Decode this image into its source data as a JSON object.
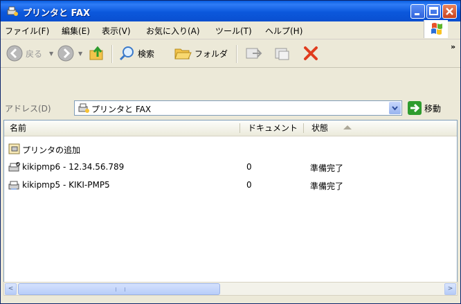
{
  "window": {
    "title": "プリンタと FAX"
  },
  "menu": [
    "ファイル(F)",
    "編集(E)",
    "表示(V)",
    "お気に入り(A)",
    "ツール(T)",
    "ヘルプ(H)"
  ],
  "toolbar": {
    "back_label": "戻る",
    "search_label": "検索",
    "folders_label": "フォルダ",
    "more": "»"
  },
  "address": {
    "label": "アドレス(D)",
    "value": "プリンタと FAX",
    "go_label": "移動"
  },
  "columns": {
    "name": "名前",
    "documents": "ドキュメント",
    "status": "状態"
  },
  "rows": [
    {
      "name": "プリンタの追加",
      "documents": "",
      "status": "",
      "icon": "add-printer-icon"
    },
    {
      "name": "kikipmp6 - 12.34.56.789",
      "documents": "0",
      "status": "準備完了",
      "icon": "printer-default-icon"
    },
    {
      "name": "kikipmp5 - KIKI-PMP5",
      "documents": "0",
      "status": "準備完了",
      "icon": "printer-icon"
    }
  ],
  "scroll": {
    "left_arrow": "<",
    "right_arrow": ">"
  },
  "colors": {
    "title_bar": "#0b58dc",
    "close_button": "#c9431e",
    "go_arrow": "#2e9c2e",
    "delete_icon": "#e03c1e"
  }
}
